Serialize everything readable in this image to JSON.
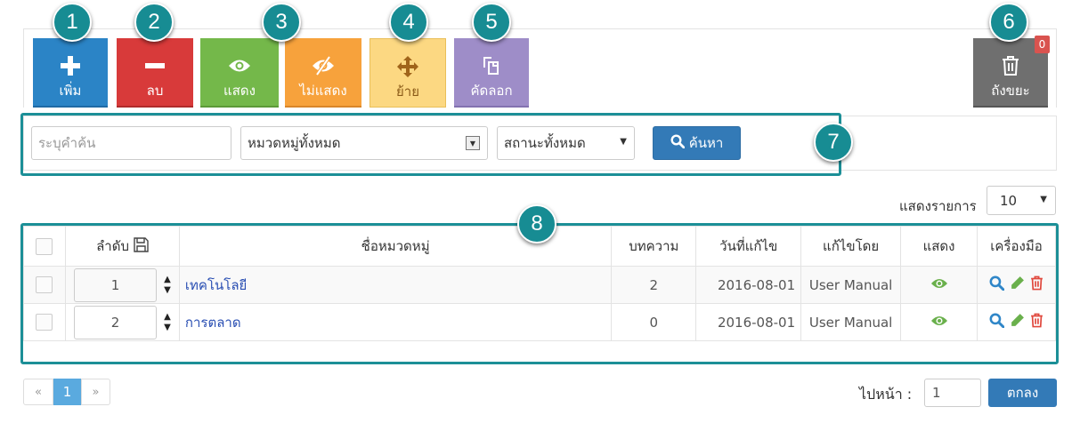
{
  "toolbar": {
    "add_label": "เพิ่ม",
    "delete_label": "ลบ",
    "show_label": "แสดง",
    "hide_label": "ไม่แสดง",
    "move_label": "ย้าย",
    "copy_label": "คัดลอก",
    "trash_label": "ถังขยะ",
    "trash_count": "0"
  },
  "callouts": [
    "1",
    "2",
    "3",
    "4",
    "5",
    "6",
    "7",
    "8"
  ],
  "search": {
    "keyword_placeholder": "ระบุคำค้น",
    "category_value": "หมวดหมู่ทั้งหมด",
    "status_value": "สถานะทั้งหมด",
    "search_label": "ค้นหา"
  },
  "display": {
    "show_entries_label": "แสดงรายการ",
    "show_entries_value": "10"
  },
  "table": {
    "columns": [
      "ลำดับ",
      "ชื่อหมวดหมู่",
      "บทความ",
      "วันที่แก้ไข",
      "แก้ไขโดย",
      "แสดง",
      "เครื่องมือ"
    ],
    "rows": [
      {
        "order": "1",
        "name": "เทคโนโลยี",
        "articles": "2",
        "modified": "2016-08-01",
        "modified_by": "User Manual"
      },
      {
        "order": "2",
        "name": "การตลาด",
        "articles": "0",
        "modified": "2016-08-01",
        "modified_by": "User Manual"
      }
    ]
  },
  "pagination": {
    "prev": "«",
    "current": "1",
    "next": "»",
    "goto_label": "ไปหน้า :",
    "goto_value": "1",
    "ok_label": "ตกลง"
  },
  "colors": {
    "callout": "#178c93",
    "add": "#2b84c6",
    "delete": "#d83a3a",
    "show": "#74b84a",
    "hide": "#f7a23c",
    "move": "#fcd882",
    "copy": "#9e8dc8",
    "trash": "#6f6f6f",
    "primary": "#337ab7"
  }
}
